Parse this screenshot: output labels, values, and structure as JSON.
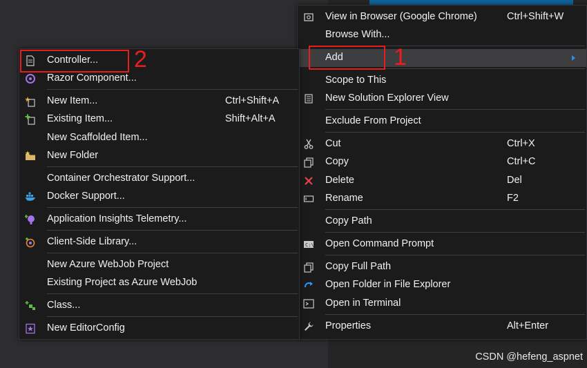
{
  "background": {
    "tree_selected_color": "#0e639c"
  },
  "context_menu": {
    "items": [
      {
        "label": "View in Browser (Google Chrome)",
        "shortcut": "Ctrl+Shift+W",
        "icon": "browser-icon"
      },
      {
        "label": "Browse With...",
        "shortcut": ""
      },
      {
        "label": "Add",
        "shortcut": "",
        "has_submenu": true,
        "highlighted": true
      },
      {
        "label": "Scope to This",
        "shortcut": ""
      },
      {
        "label": "New Solution Explorer View",
        "shortcut": "",
        "icon": "solution-explorer-icon"
      },
      {
        "label": "Exclude From Project",
        "shortcut": ""
      },
      {
        "label": "Cut",
        "shortcut": "Ctrl+X",
        "icon": "scissors-icon"
      },
      {
        "label": "Copy",
        "shortcut": "Ctrl+C",
        "icon": "copy-icon"
      },
      {
        "label": "Delete",
        "shortcut": "Del",
        "icon": "delete-x-icon"
      },
      {
        "label": "Rename",
        "shortcut": "F2",
        "icon": "rename-icon"
      },
      {
        "label": "Copy Path",
        "shortcut": ""
      },
      {
        "label": "Open Command Prompt",
        "shortcut": "",
        "icon": "command-prompt-icon"
      },
      {
        "label": "Copy Full Path",
        "shortcut": "",
        "icon": "copy-icon"
      },
      {
        "label": "Open Folder in File Explorer",
        "shortcut": "",
        "icon": "refresh-arrow-icon"
      },
      {
        "label": "Open in Terminal",
        "shortcut": "",
        "icon": "terminal-icon"
      },
      {
        "label": "Properties",
        "shortcut": "Alt+Enter",
        "icon": "wrench-icon"
      }
    ]
  },
  "add_submenu": {
    "items": [
      {
        "label": "Controller...",
        "shortcut": "",
        "icon": "controller-file-icon"
      },
      {
        "label": "Razor Component...",
        "shortcut": "",
        "icon": "razor-icon"
      },
      {
        "label": "New Item...",
        "shortcut": "Ctrl+Shift+A",
        "icon": "new-item-icon"
      },
      {
        "label": "Existing Item...",
        "shortcut": "Shift+Alt+A",
        "icon": "existing-item-icon"
      },
      {
        "label": "New Scaffolded Item...",
        "shortcut": ""
      },
      {
        "label": "New Folder",
        "shortcut": "",
        "icon": "new-folder-icon"
      },
      {
        "label": "Container Orchestrator Support...",
        "shortcut": ""
      },
      {
        "label": "Docker Support...",
        "shortcut": "",
        "icon": "docker-icon"
      },
      {
        "label": "Application Insights Telemetry...",
        "shortcut": "",
        "icon": "insights-icon"
      },
      {
        "label": "Client-Side Library...",
        "shortcut": "",
        "icon": "library-icon"
      },
      {
        "label": "New Azure WebJob Project",
        "shortcut": ""
      },
      {
        "label": "Existing Project as Azure WebJob",
        "shortcut": ""
      },
      {
        "label": "Class...",
        "shortcut": "",
        "icon": "class-icon"
      },
      {
        "label": "New EditorConfig",
        "shortcut": "",
        "icon": "editorconfig-icon"
      }
    ]
  },
  "annotations": {
    "step1": "1",
    "step2": "2",
    "color": "#e81e1e"
  },
  "watermark": "CSDN @hefeng_aspnet"
}
